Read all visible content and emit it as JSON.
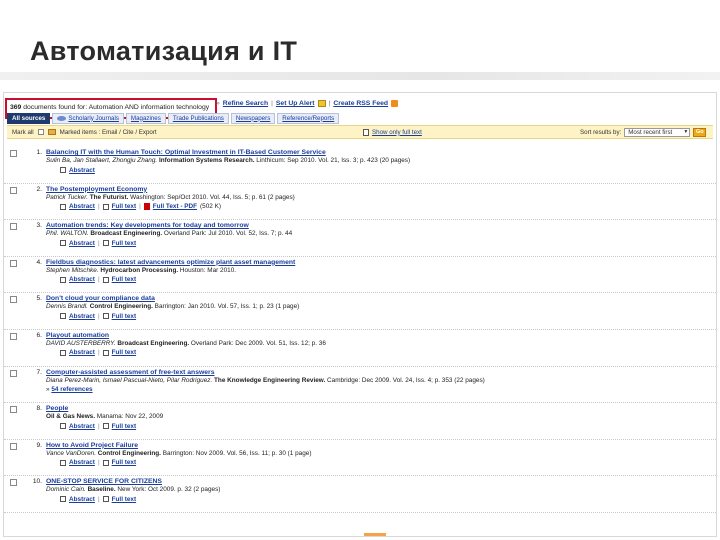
{
  "slide": {
    "title": "Автоматизация и IT"
  },
  "search": {
    "count": "369",
    "found_text": " documents found for: Automation AND information technology",
    "links": [
      {
        "label": "Refine Search"
      },
      {
        "label": "Set Up Alert"
      },
      {
        "label": "Create RSS Feed"
      }
    ]
  },
  "tabs": [
    {
      "label": "All sources",
      "active": true
    },
    {
      "label": "Scholarly Journals",
      "active": false
    },
    {
      "label": "Magazines",
      "active": false
    },
    {
      "label": "Trade Publications",
      "active": false
    },
    {
      "label": "Newspapers",
      "active": false
    },
    {
      "label": "Reference/Reports",
      "active": false
    }
  ],
  "toolbar": {
    "mark_all": "Mark all",
    "marked_items": "Marked items : Email / Cite / Export",
    "show_only": "Show only full text",
    "sort_label": "Sort results by:",
    "sort_value": "Most recent first",
    "go": "Go"
  },
  "results": [
    {
      "num": "1.",
      "title": "Balancing IT with the Human Touch: Optimal Investment in IT-Based Customer Service",
      "authors": "Sulin Ba, Jan Stallaert, Zhongju Zhang.",
      "source": "Information Systems Research.",
      "details": " Linthicum: Sep 2010. Vol. 21, Iss. 3; p. 423 (20 pages)",
      "links": [
        "Abstract"
      ]
    },
    {
      "num": "2.",
      "title": "The Postemployment Economy",
      "authors": "Patrick Tucker.",
      "source": "The Futurist.",
      "details": " Washington: Sep/Oct 2010. Vol. 44, Iss. 5; p. 61 (2 pages)",
      "links": [
        "Abstract",
        "Full text",
        "Full Text - PDF"
      ],
      "pdf_size": "(502 K)"
    },
    {
      "num": "3.",
      "title": "Automation trends: Key developments for today and tomorrow",
      "authors": "Phil. WALTON.",
      "source": "Broadcast Engineering.",
      "details": " Overland Park: Jul 2010. Vol. 52, Iss. 7; p. 44",
      "links": [
        "Abstract",
        "Full text"
      ]
    },
    {
      "num": "4.",
      "title": "Fieldbus diagnostics: latest advancements optimize plant asset management",
      "authors": "Stephen Mitschke.",
      "source": "Hydrocarbon Processing.",
      "details": " Houston: Mar 2010.",
      "links": [
        "Abstract",
        "Full text"
      ]
    },
    {
      "num": "5.",
      "title": "Don't cloud your compliance data",
      "authors": "Dennis Brandl.",
      "source": "Control Engineering.",
      "details": " Barrington: Jan 2010. Vol. 57, Iss. 1; p. 23 (1 page)",
      "links": [
        "Abstract",
        "Full text"
      ]
    },
    {
      "num": "6.",
      "title": "Playout automation",
      "authors": "DAVID AUSTERBERRY.",
      "source": "Broadcast Engineering.",
      "details": " Overland Park: Dec 2009. Vol. 51, Iss. 12; p. 36",
      "links": [
        "Abstract",
        "Full text"
      ]
    },
    {
      "num": "7.",
      "title": "Computer-assisted assessment of free-text answers",
      "authors": "Diana Perez-Marin, Ismael Pascual-Nieto, Pilar Rodriguez.",
      "source": "The Knowledge Engineering Review.",
      "details": " Cambridge: Dec 2009. Vol. 24, Iss. 4; p. 353 (22 pages)",
      "links": [],
      "refs": "54 references"
    },
    {
      "num": "8.",
      "title": "People",
      "authors": "",
      "source": "Oil & Gas News.",
      "details": " Manama: Nov 22, 2009",
      "links": [
        "Abstract",
        "Full text"
      ]
    },
    {
      "num": "9.",
      "title": "How to Avoid Project Failure",
      "authors": "Vance VanDoren.",
      "source": "Control Engineering.",
      "details": " Barrington: Nov 2009. Vol. 56, Iss. 11; p. 30 (1 page)",
      "links": [
        "Abstract",
        "Full text"
      ]
    },
    {
      "num": "10.",
      "title": "ONE-STOP SERVICE FOR CITIZENS",
      "authors": "Dominic Cain.",
      "source": "Baseline.",
      "details": " New York: Oct 2009. p. 32 (2 pages)",
      "links": [
        "Abstract",
        "Full text"
      ]
    }
  ],
  "colors": {
    "highlight": "#c8102e",
    "link": "#1a3d9c",
    "toolbar": "#fdf3c4",
    "active_tab": "#1e3a6e"
  }
}
